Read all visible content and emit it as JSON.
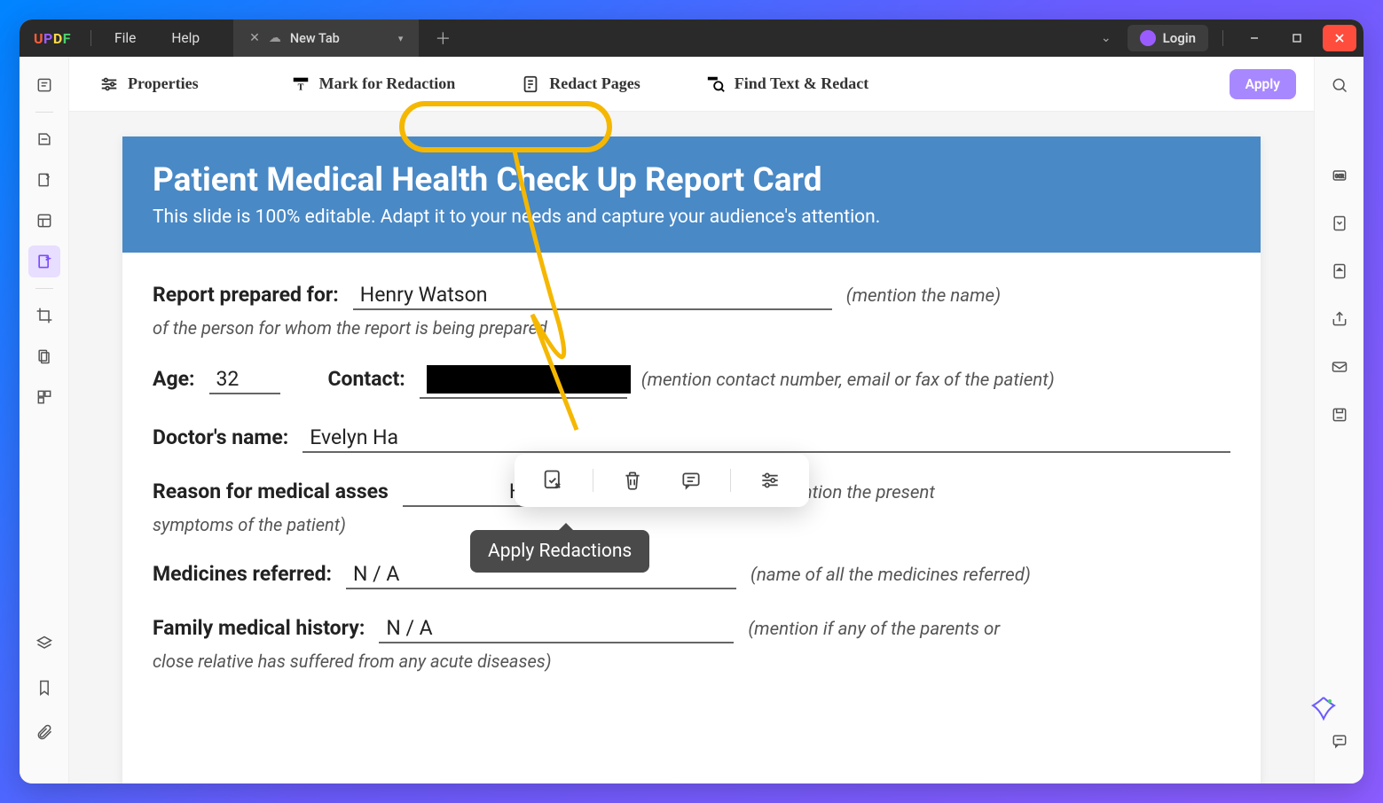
{
  "app": {
    "name": "UPDF"
  },
  "menus": {
    "file": "File",
    "help": "Help"
  },
  "tab": {
    "label": "New Tab"
  },
  "auth": {
    "login": "Login"
  },
  "toolbar": {
    "properties": "Properties",
    "mark_for_redaction": "Mark for Redaction",
    "redact_pages": "Redact Pages",
    "find_text_redact": "Find Text & Redact",
    "apply": "Apply"
  },
  "document": {
    "title": "Patient Medical Health Check Up Report Card",
    "subtitle": "This slide is 100% editable. Adapt it to your needs and capture your audience's attention.",
    "fields": {
      "report_prepared_for_label": "Report prepared for:",
      "report_prepared_for_value": "Henry Watson",
      "report_prepared_for_hint": "(mention the name)",
      "report_prepared_for_note": "of the person for whom the report is being prepared",
      "age_label": "Age:",
      "age_value": "32",
      "contact_label": "Contact:",
      "contact_hint": "(mention contact number, email or fax of the patient)",
      "doctor_label": "Doctor's name:",
      "doctor_value": "Evelyn  Ha",
      "reason_label": "Reason for medical asses",
      "reason_value": "High Blood Pressure",
      "reason_hint": "(mention the present",
      "reason_note": "symptoms of the patient)",
      "medicines_label": "Medicines referred:",
      "medicines_value": "N / A",
      "medicines_hint": "(name of all the medicines referred)",
      "family_label": "Family medical history:",
      "family_value": "N / A",
      "family_hint": "(mention if any of the parents or",
      "family_note": "close relative has suffered from any acute diseases)"
    }
  },
  "tooltip": {
    "apply_redactions": "Apply Redactions"
  }
}
